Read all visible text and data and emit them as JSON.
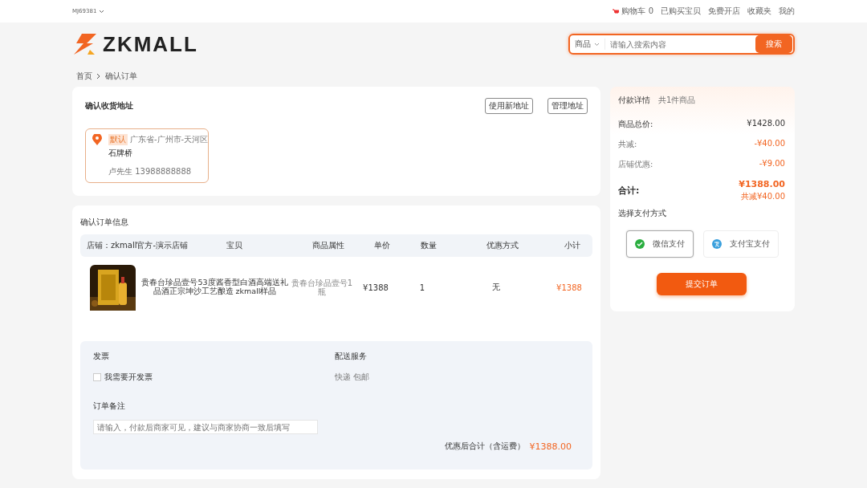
{
  "top_bar": {
    "account": "MJ69381",
    "cart": {
      "label": "购物车",
      "count": "0"
    },
    "links": [
      "已购买宝贝",
      "免费开店",
      "收藏夹",
      "我的"
    ]
  },
  "header": {
    "logo": "ZKMALL",
    "search": {
      "category": "商品",
      "placeholder": "请输入搜索内容",
      "button": "搜索"
    }
  },
  "breadcrumb": [
    "首页",
    "确认订单"
  ],
  "address": {
    "title": "确认收货地址",
    "buttons": [
      "使用新地址",
      "管理地址"
    ],
    "card": {
      "tag": "默认",
      "region": "广东省-广州市-天河区",
      "detail": "石牌桥",
      "contact": "卢先生 13988888888"
    }
  },
  "order": {
    "title": "确认订单信息",
    "shop": "店铺：zkmall官方-演示店铺",
    "columns": [
      "宝贝",
      "商品属性",
      "单价",
      "数量",
      "优惠方式",
      "小计"
    ],
    "items": [
      {
        "kind": "picture",
        "name": "贵春台珍品壹号53度酱香型白酒高端送礼品酒正宗坤沙工艺酿造 zkmall样品",
        "attribute": "贵春台珍品壹号1瓶",
        "price": "¥1388",
        "quantity": "1",
        "discount": "无",
        "subtotal": "¥1388"
      }
    ],
    "invoice": {
      "title": "发票",
      "option": {
        "label": "我需要开发票",
        "checked": false
      }
    },
    "delivery": {
      "title": "配送服务",
      "value": "快递 包邮"
    },
    "note": {
      "title": "订单备注",
      "placeholder": "请输入，付款后商家可见，建议与商家协商一致后填写"
    },
    "total": {
      "label": "优惠后合计（含运费）",
      "value": "¥1388.00"
    }
  },
  "payment": {
    "title": "付款详情",
    "count": "共1件商品",
    "lines": [
      {
        "kind": "normal",
        "label": "商品总价:",
        "value": "¥1428.00"
      },
      {
        "kind": "discount",
        "label": "共减:",
        "value": "-¥40.00"
      },
      {
        "kind": "discount",
        "label": "店铺优惠:",
        "value": "-¥9.00"
      }
    ],
    "total": {
      "label": "合计:",
      "value": "¥1388.00",
      "saved": "共减¥40.00"
    },
    "method_title": "选择支付方式",
    "methods": [
      {
        "kind": "wechat",
        "label": "微信支付",
        "selected": true
      },
      {
        "kind": "alipay",
        "label": "支付宝支付",
        "selected": false
      }
    ],
    "submit": "提交订单"
  }
}
